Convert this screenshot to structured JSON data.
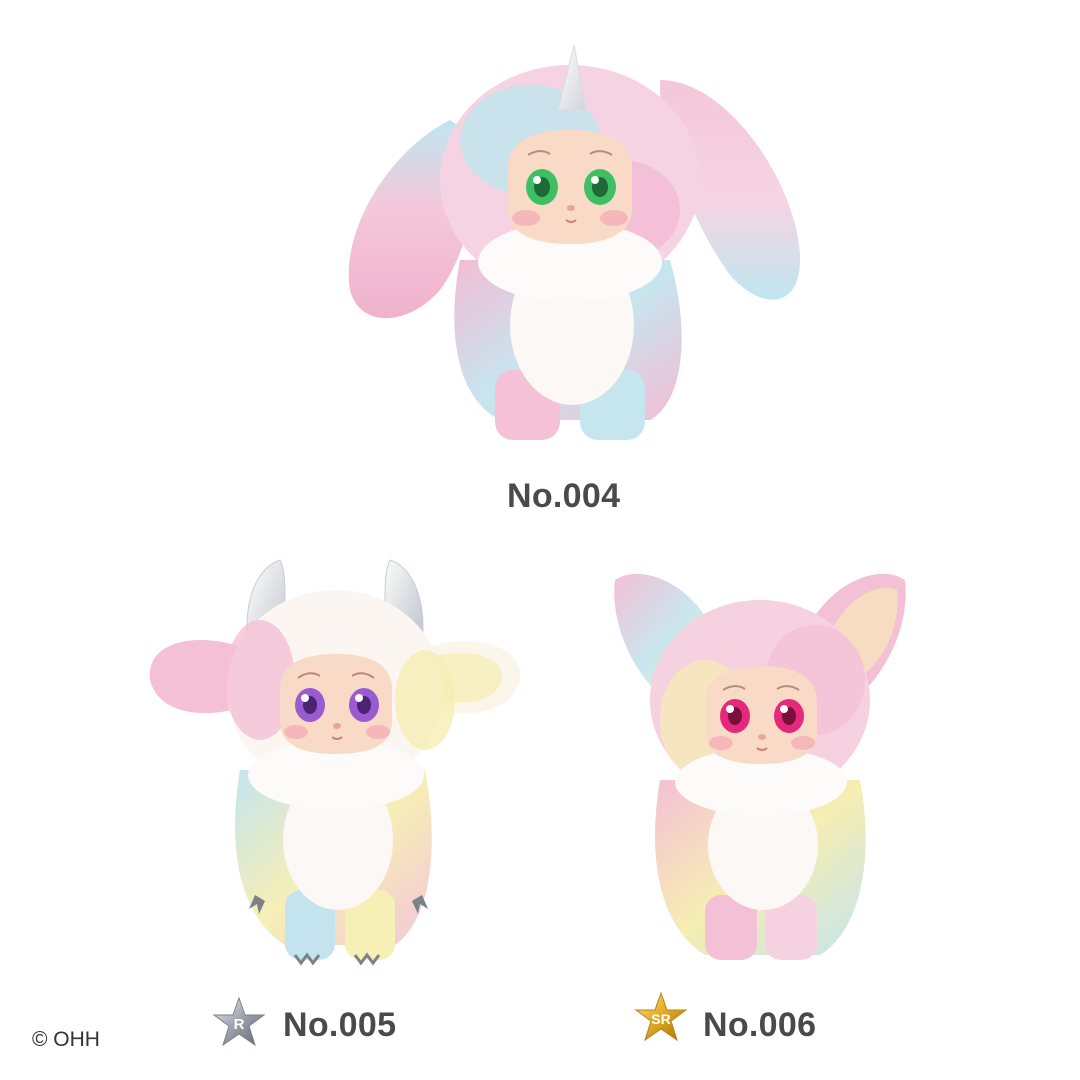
{
  "figures": [
    {
      "label": "No.004",
      "character": "unicorn-bunny",
      "eye_color": "#3fbf63",
      "rarity": ""
    },
    {
      "label": "No.005",
      "character": "ram",
      "eye_color": "#9a5bd0",
      "rarity": "R",
      "rarity_color": "#b9bec8"
    },
    {
      "label": "No.006",
      "character": "fox",
      "eye_color": "#e5287a",
      "rarity": "SR",
      "rarity_color": "#e0a721"
    }
  ],
  "copyright": "© OHH",
  "colors": {
    "label_text": "#4a4a4a",
    "fur_pink": "#f4bfd6",
    "fur_blue": "#bfe6ef",
    "fur_yellow": "#f6eeb2",
    "fur_white": "#fbf8f6",
    "skin": "#f8dac6"
  }
}
